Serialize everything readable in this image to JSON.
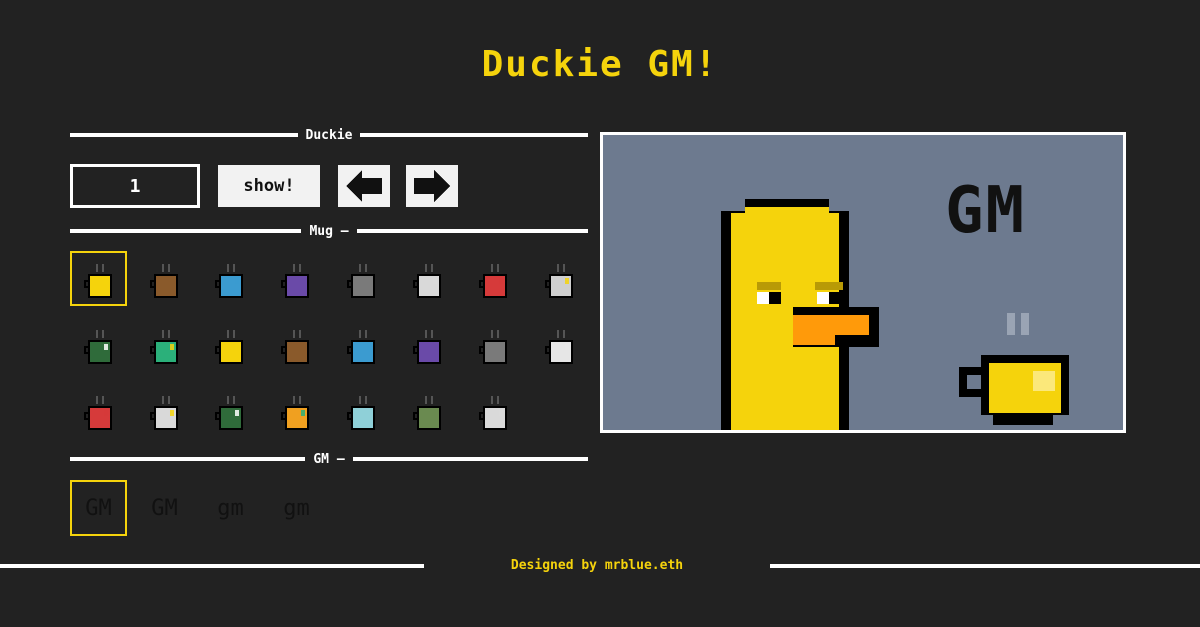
{
  "title": "Duckie GM!",
  "sections": {
    "duckie": "Duckie",
    "mug": "Mug –",
    "gm": "GM –"
  },
  "controls": {
    "duckie_id": "1",
    "show_label": "show!",
    "prev_icon": "arrow-left-icon",
    "next_icon": "arrow-right-icon"
  },
  "mugs": {
    "selected_index": 0,
    "items": [
      {
        "color": "#f5d30c"
      },
      {
        "color": "#8a5a2b"
      },
      {
        "color": "#3b9bd0"
      },
      {
        "color": "#6a4aa8"
      },
      {
        "color": "#7a7a7a"
      },
      {
        "color": "#d9d9d9"
      },
      {
        "color": "#d63a3a"
      },
      {
        "color": "#cfcfcf",
        "accent": "#f5d30c"
      },
      {
        "color": "#2f6b3a",
        "accent": "#ffffff"
      },
      {
        "color": "#2bb07a",
        "accent": "#f5d30c"
      },
      {
        "color": "#f5d30c"
      },
      {
        "color": "#8a5a2b"
      },
      {
        "color": "#3b9bd0"
      },
      {
        "color": "#6a4aa8"
      },
      {
        "color": "#7a7a7a"
      },
      {
        "color": "#e6e6e6"
      },
      {
        "color": "#d63a3a"
      },
      {
        "color": "#d9d9d9",
        "accent": "#f5d30c"
      },
      {
        "color": "#2f6b3a",
        "accent": "#ffffff"
      },
      {
        "color": "#f0a020",
        "accent": "#2bb07a"
      },
      {
        "color": "#8fd0d8"
      },
      {
        "color": "#6a8a50"
      },
      {
        "color": "#d9d9d9"
      }
    ]
  },
  "gm_options": {
    "selected_index": 0,
    "items": [
      "GM",
      "GM",
      "gm",
      "gm"
    ]
  },
  "preview": {
    "text": "GM",
    "background": "#6d7a8f",
    "duck_color": "#f5d30c",
    "beak_color": "#ff9a0a",
    "mug_color": "#f5d30c"
  },
  "footer": "Designed by mrblue.eth"
}
